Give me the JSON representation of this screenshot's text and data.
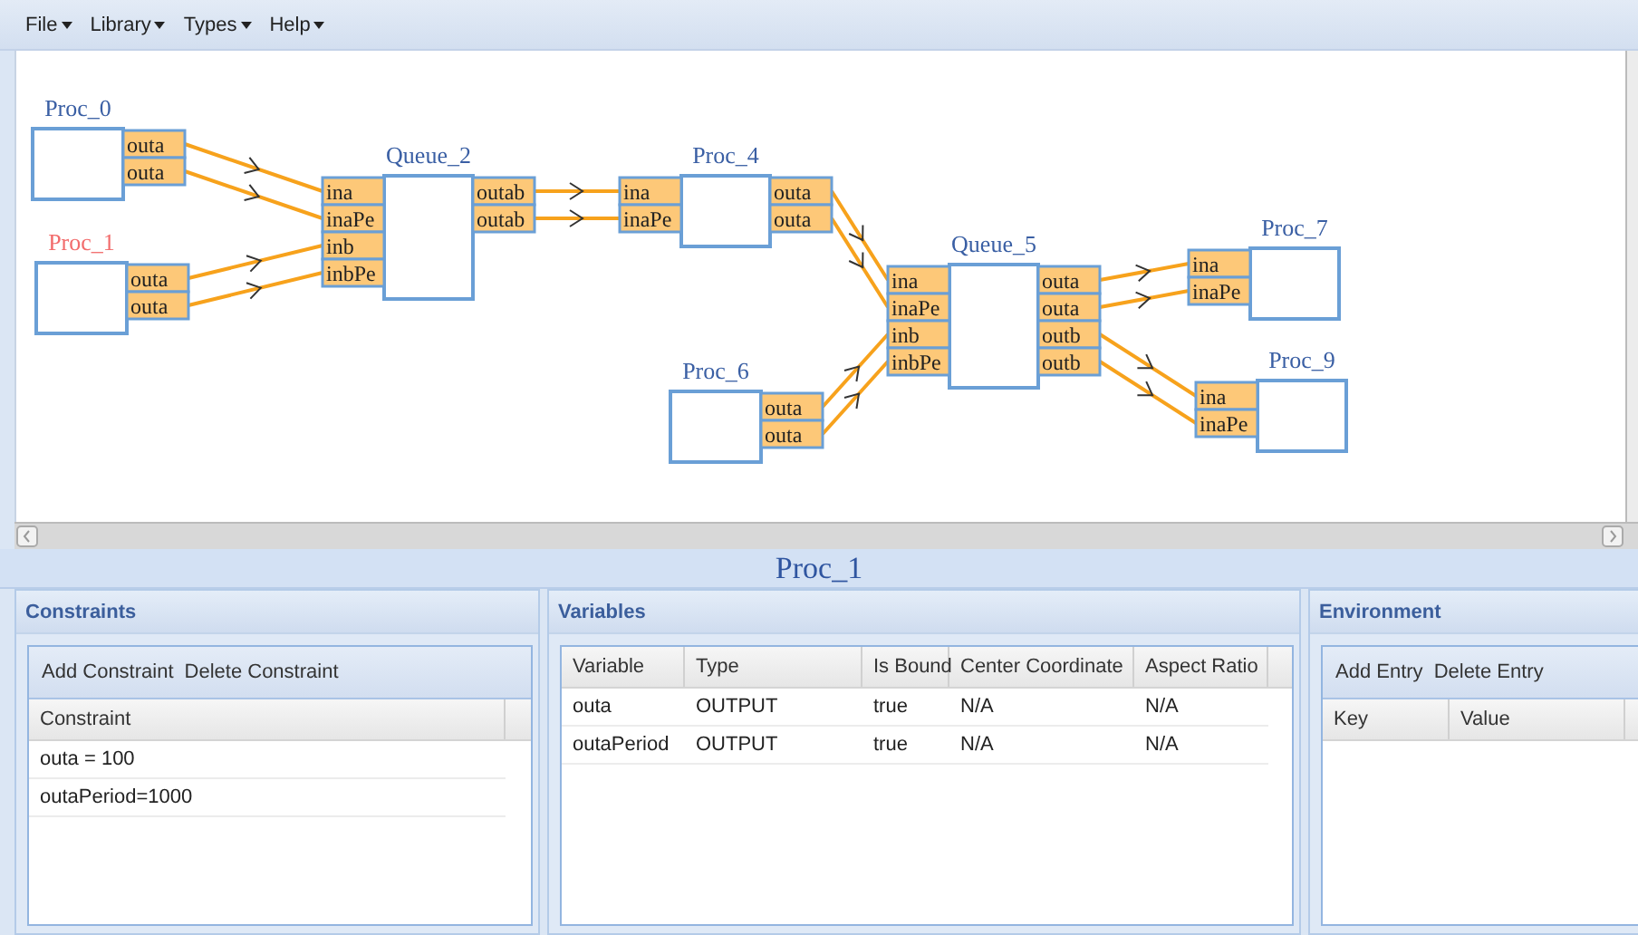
{
  "menu": [
    "File",
    "Library",
    "Types",
    "Help"
  ],
  "canvas": {
    "nodes": [
      {
        "name": "Proc_0",
        "selected": false,
        "outputs": [
          "outa",
          "outa"
        ]
      },
      {
        "name": "Proc_1",
        "selected": true,
        "outputs": [
          "outa",
          "outa"
        ]
      },
      {
        "name": "Queue_2",
        "selected": false,
        "inputs": [
          "ina",
          "inaPe",
          "inb",
          "inbPe"
        ],
        "outputs": [
          "outab",
          "outab"
        ]
      },
      {
        "name": "Proc_4",
        "selected": false,
        "inputs": [
          "ina",
          "inaPe"
        ],
        "outputs": [
          "outa",
          "outa"
        ]
      },
      {
        "name": "Queue_5",
        "selected": false,
        "inputs": [
          "ina",
          "inaPe",
          "inb",
          "inbPe"
        ],
        "outputs": [
          "outa",
          "outa",
          "outb",
          "outb"
        ]
      },
      {
        "name": "Proc_6",
        "selected": false,
        "outputs": [
          "outa",
          "outa"
        ]
      },
      {
        "name": "Proc_7",
        "selected": false,
        "inputs": [
          "ina",
          "inaPe"
        ]
      },
      {
        "name": "Proc_9",
        "selected": false,
        "inputs": [
          "ina",
          "inaPe"
        ]
      }
    ]
  },
  "details": {
    "title": "Proc_1",
    "constraints": {
      "title": "Constraints",
      "actions": [
        "Add Constraint",
        "Delete Constraint"
      ],
      "columns": [
        "Constraint"
      ],
      "rows": [
        [
          "outa = 100"
        ],
        [
          "outaPeriod=1000"
        ]
      ]
    },
    "variables": {
      "title": "Variables",
      "columns": [
        "Variable",
        "Type",
        "Is Bound",
        "Center Coordinate",
        "Aspect Ratio"
      ],
      "rows": [
        [
          "outa",
          "OUTPUT",
          "true",
          "N/A",
          "N/A"
        ],
        [
          "outaPeriod",
          "OUTPUT",
          "true",
          "N/A",
          "N/A"
        ]
      ]
    },
    "environment": {
      "title": "Environment",
      "actions": [
        "Add Entry",
        "Delete Entry"
      ],
      "columns": [
        "Key",
        "Value"
      ]
    }
  }
}
